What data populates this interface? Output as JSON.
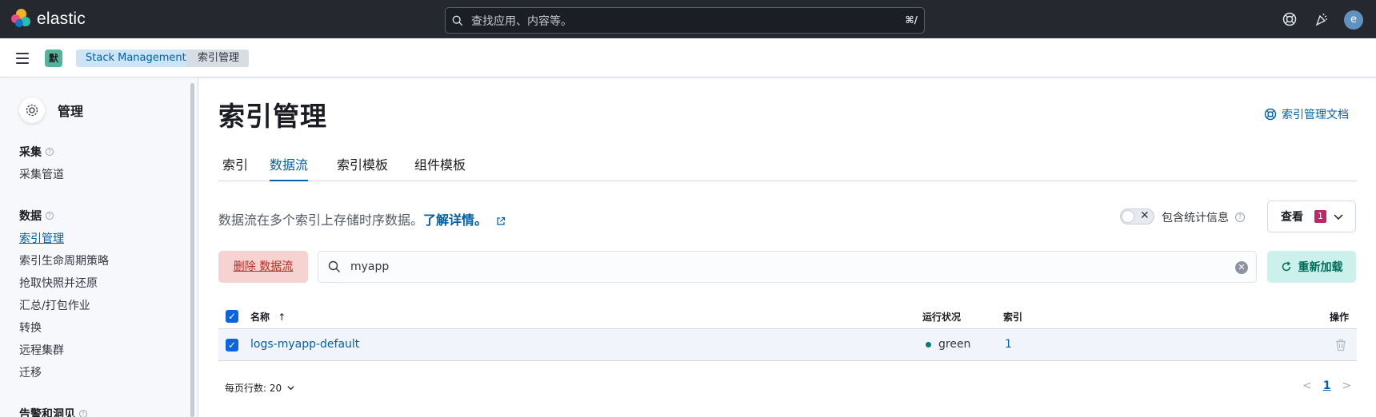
{
  "header": {
    "brand": "elastic",
    "search_placeholder": "查找应用、内容等。",
    "search_shortcut": "⌘/",
    "avatar_initial": "e",
    "icons": [
      "help-icon",
      "newsfeed-icon"
    ]
  },
  "breadcrumb": {
    "space_initial": "默",
    "items": [
      "Stack Management",
      "索引管理"
    ]
  },
  "sidebar": {
    "title": "管理",
    "sections": [
      {
        "label": "采集",
        "items": [
          "采集管道"
        ]
      },
      {
        "label": "数据",
        "items": [
          "索引管理",
          "索引生命周期策略",
          "抢取快照并还原",
          "汇总/打包作业",
          "转换",
          "远程集群",
          "迁移"
        ]
      },
      {
        "label": "告警和洞见",
        "items": []
      }
    ],
    "active_item": "索引管理"
  },
  "main": {
    "title": "索引管理",
    "doc_link": "索引管理文档",
    "tabs": [
      "索引",
      "数据流",
      "索引模板",
      "组件模板"
    ],
    "selected_tab": "数据流",
    "description": "数据流在多个索引上存储时序数据。",
    "learn_more": "了解详情。",
    "include_stats_label": "包含统计信息",
    "include_stats_on": false,
    "view_button": "查看",
    "view_count": "1",
    "delete_button": "删除 数据流",
    "search_value": "myapp",
    "reload_button": "重新加载"
  },
  "table": {
    "columns": {
      "name": "名称",
      "health": "运行状况",
      "indices": "索引",
      "actions": "操作"
    },
    "sort_indicator": "↑",
    "rows": [
      {
        "name": "logs-myapp-default",
        "health": "green",
        "indices": "1",
        "selected": true
      }
    ]
  },
  "pagination": {
    "rows_per_page_label": "每页行数: 20",
    "current_page": "1"
  },
  "colors": {
    "accent": "#0061a6",
    "health_green": "#007e77",
    "danger": "#bd271e",
    "success_bg": "#ccf0eb"
  }
}
